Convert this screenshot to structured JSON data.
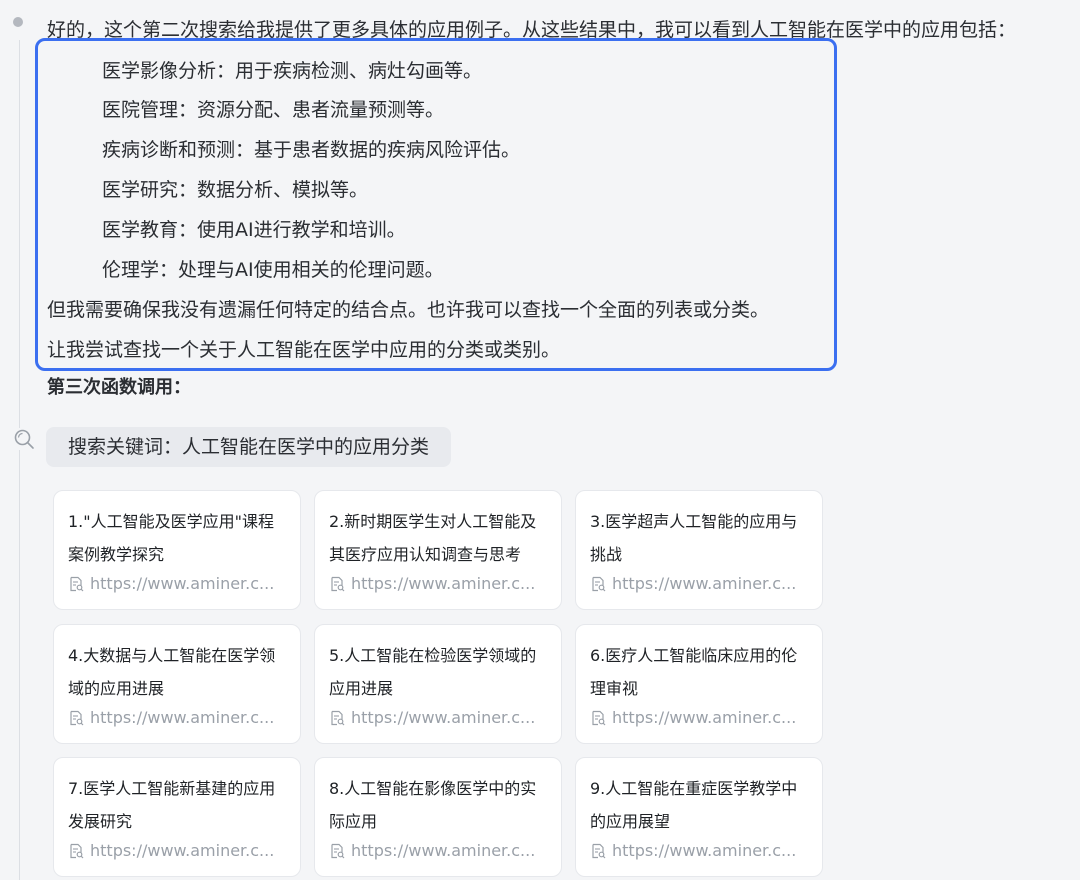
{
  "intro_text": "好的，这个第二次搜索给我提供了更多具体的应用例子。从这些结果中，我可以看到人工智能在医学中的应用包括：",
  "applications": [
    "医学影像分析：用于疾病检测、病灶勾画等。",
    "医院管理：资源分配、患者流量预测等。",
    "疾病诊断和预测：基于患者数据的疾病风险评估。",
    "医学研究：数据分析、模拟等。",
    "医学教育：使用AI进行教学和培训。",
    "伦理学：处理与AI使用相关的伦理问题。"
  ],
  "followup_lines": [
    "但我需要确保我没有遗漏任何特定的结合点。也许我可以查找一个全面的列表或分类。",
    "让我尝试查找一个关于人工智能在医学中应用的分类或类别。"
  ],
  "section_heading": "第三次函数调用：",
  "search_query": "搜索关键词：人工智能在医学中的应用分类",
  "results": [
    {
      "title": "1.\"人工智能及医学应用\"课程案例教学探究",
      "url": "https://www.aminer.c..."
    },
    {
      "title": "2.新时期医学生对人工智能及其医疗应用认知调查与思考",
      "url": "https://www.aminer.c..."
    },
    {
      "title": "3.医学超声人工智能的应用与挑战",
      "url": "https://www.aminer.c..."
    },
    {
      "title": "4.大数据与人工智能在医学领域的应用进展",
      "url": "https://www.aminer.c..."
    },
    {
      "title": "5.人工智能在检验医学领域的应用进展",
      "url": "https://www.aminer.c..."
    },
    {
      "title": "6.医疗人工智能临床应用的伦理审视",
      "url": "https://www.aminer.c..."
    },
    {
      "title": "7.医学人工智能新基建的应用发展研究",
      "url": "https://www.aminer.c..."
    },
    {
      "title": "8.人工智能在影像医学中的实际应用",
      "url": "https://www.aminer.c..."
    },
    {
      "title": "9.人工智能在重症医学教学中的应用展望",
      "url": "https://www.aminer.c..."
    }
  ],
  "colors": {
    "highlight": "#3b6ff0",
    "background": "#f4f5f7",
    "card": "#ffffff",
    "muted": "#9aa0a8"
  },
  "icons": {
    "bullet": "bullet-dot-icon",
    "search": "search-icon",
    "document": "document-search-icon"
  }
}
